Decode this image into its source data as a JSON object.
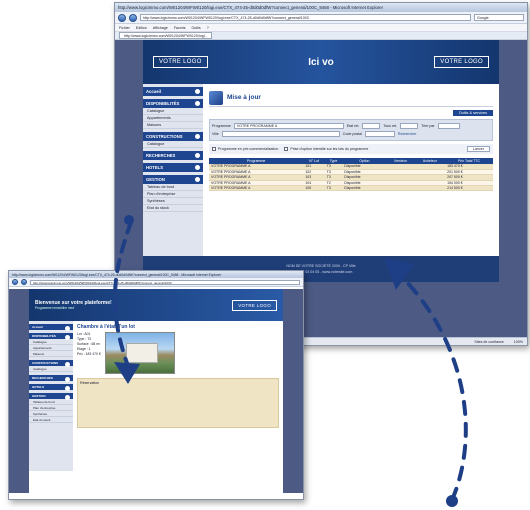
{
  "browser": {
    "title_large": "http://www.logicimmo.com/W01204/WFW0120/logi.exe/CTX_474-25-d0d0d0dfW?connect_general/100C_9458 - Microsoft Internet Explorer",
    "title_small": "http://www.logicimmo.com/W01204/WFW0120/logi.exe/CTX_474-25-d0d0d0dfW?connect_general/100C_9458 - Microsoft Internet Explorer",
    "url": "http://www.logicimmo.com/W01204/WFW0120/logi.exe/CTX_474-25-d0d0d0dfW?connect_general/100C",
    "search": "Google",
    "menu": [
      "Fichier",
      "Edition",
      "Affichage",
      "Favoris",
      "Outils",
      "?"
    ],
    "tab": "http://www.logicimmo.com/W01204/WFW0120/logi...",
    "status": [
      "Sites de confiance",
      "100%"
    ]
  },
  "site": {
    "logo_left": "VOTRE LOGO",
    "logo_right": "VOTRE LOGO",
    "hero": "Ici vo",
    "footer_line1": "NOM DE VOTRE SOCIÉTÉ 2009 - CP Ville",
    "footer_line2": "Tel 01 02 03 04 05 - www.votresite.com"
  },
  "sidebar": [
    {
      "head": "Accueil",
      "items": []
    },
    {
      "head": "DISPONIBILITÉS",
      "items": [
        "Catalogue",
        "Appartements",
        "Maisons"
      ]
    },
    {
      "head": "CONSTRUCTIONS",
      "items": [
        "Catalogue"
      ]
    },
    {
      "head": "RECHERCHES",
      "items": []
    },
    {
      "head": "HOTELS",
      "items": []
    },
    {
      "head": "GESTION",
      "items": [
        "Tableau de bord",
        "Plan d'entreprise",
        "Synthèses",
        "Etat du stock"
      ]
    }
  ],
  "main": {
    "title": "Mise à jour",
    "button": "Outils & services",
    "filters": {
      "programme_label": "Programme",
      "programme_value": "VOTRE PROGRAMME A",
      "ville_label": "Ville",
      "etat_label": "Etat ret.",
      "type_label": "Tous ret.",
      "tri_label": "Trier par",
      "code_label": "Code postal",
      "rechercher": "Rechercher"
    },
    "checks": [
      "Programme en prix commercialisation",
      "Prise d'option interdite sur les lots du programme"
    ],
    "lancer": "Lancer",
    "columns": [
      "Programme",
      "N° Lot",
      "Type",
      "Option",
      "Vendeur",
      "Acheteur",
      "Prix Total TTC"
    ],
    "rows": [
      [
        "VOTRE PROGRAMME A",
        "101",
        "T3",
        "Disponible",
        "",
        "",
        "183 470 €"
      ],
      [
        "VOTRE PROGRAMME A",
        "102",
        "T3",
        "Disponible",
        "",
        "",
        "201 500 €"
      ],
      [
        "VOTRE PROGRAMME A",
        "103",
        "T3",
        "Disponible",
        "",
        "",
        "207 500 €"
      ],
      [
        "VOTRE PROGRAMME A",
        "104",
        "T2",
        "Disponible",
        "",
        "",
        "154 000 €"
      ],
      [
        "VOTRE PROGRAMME A",
        "105",
        "T3",
        "Disponible",
        "",
        "",
        "214 500 €"
      ]
    ]
  },
  "small": {
    "hero_title": "Bienvenue sur votre plateforme!",
    "hero_sub": "Programme immobilier neuf",
    "card_title": "Chambre à l'état d'un lot",
    "kv": [
      "Lot : A01",
      "Type : T3",
      "Surface : 68 m²",
      "Etage : 1",
      "Prix : 183 470 €"
    ],
    "section": "Réservation"
  }
}
